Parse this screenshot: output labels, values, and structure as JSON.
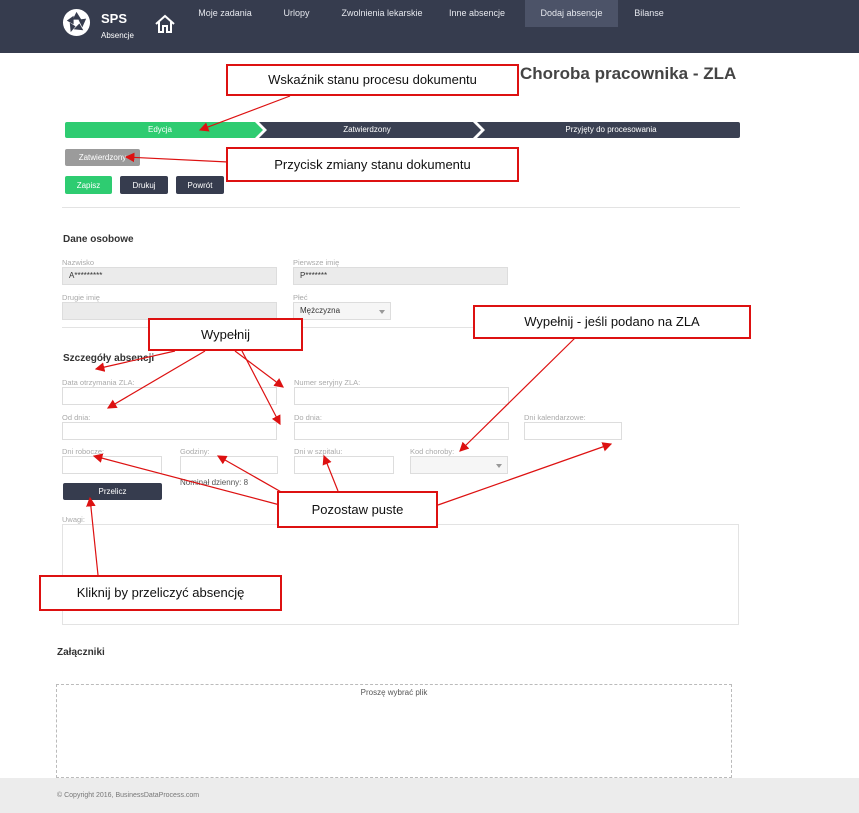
{
  "brand": {
    "name": "SPS",
    "sub": "Absencje"
  },
  "nav": [
    {
      "label": "Moje zadania"
    },
    {
      "label": "Urlopy"
    },
    {
      "label": "Zwolnienia lekarskie"
    },
    {
      "label": "Inne absencje"
    },
    {
      "label": "Dodaj absencje",
      "active": true
    },
    {
      "label": "Bilanse"
    }
  ],
  "page_title": "Choroba pracownika - ZLA",
  "steps": [
    {
      "label": "Edycja",
      "state": "active",
      "color": "#2ecc71"
    },
    {
      "label": "Zatwierdzony",
      "state": "pending",
      "color": "#3a4052"
    },
    {
      "label": "Przyjęty do procesowania",
      "state": "pending",
      "color": "#3a4052"
    }
  ],
  "status_button": "Zatwierdzony",
  "actions": {
    "save": "Zapisz",
    "print": "Drukuj",
    "back": "Powrót"
  },
  "personal": {
    "title": "Dane osobowe",
    "surname_label": "Nazwisko",
    "surname_value": "A*********",
    "firstname_label": "Pierwsze imię",
    "firstname_value": "P*******",
    "secondname_label": "Drugie imię",
    "secondname_value": "",
    "sex_label": "Płeć",
    "sex_value": "Mężczyzna"
  },
  "absence": {
    "title": "Szczegóły absencji",
    "date_received_label": "Data otrzymania ZLA:",
    "serial_label": "Numer seryjny ZLA:",
    "from_label": "Od dnia:",
    "to_label": "Do dnia:",
    "calendar_days_label": "Dni kalendarzowe:",
    "work_days_label": "Dni robocze:",
    "hours_label": "Godziny:",
    "hospital_days_label": "Dni w szpitalu:",
    "disease_code_label": "Kod choroby:",
    "nominal": "Nominał dzienny: 8",
    "recalc": "Przelicz",
    "notes_label": "Uwagi:"
  },
  "attachments": {
    "title": "Załączniki",
    "dropzone": "Proszę wybrać plik"
  },
  "annotations": {
    "process": "Wskaźnik stanu procesu dokumentu",
    "status_btn": "Przycisk zmiany stanu dokumentu",
    "fill": "Wypełnij",
    "fill_if": "Wypełnij - jeśli podano na ZLA",
    "leave_empty": "Pozostaw puste",
    "recalc": "Kliknij by przeliczyć absencję"
  },
  "footer": {
    "copyright": "© Copyright 2016, BusinessDataProcess.com"
  },
  "colors": {
    "nav": "#363c4e",
    "accent": "#2ecc71",
    "dark_button": "#363c4e",
    "annotation": "#dd1111"
  }
}
